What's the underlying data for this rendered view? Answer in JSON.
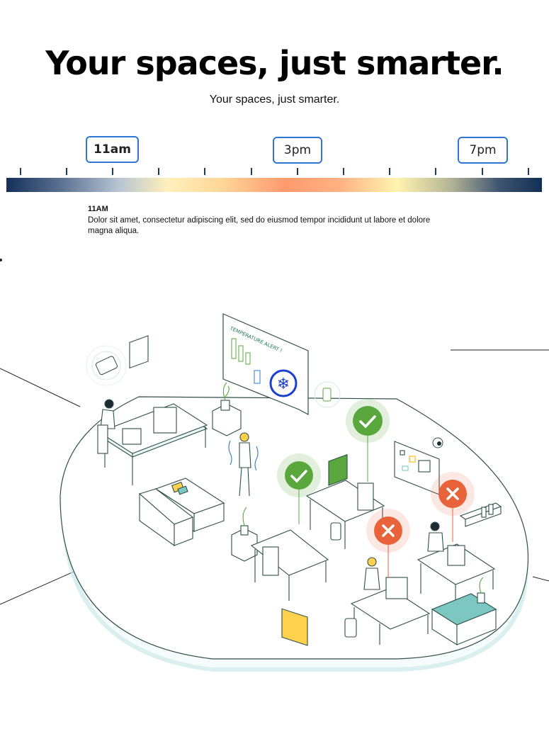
{
  "hero": {
    "headline": "Your spaces, just smarter.",
    "subheadline": "Your spaces, just smarter."
  },
  "timeline": {
    "buttons": [
      {
        "label": "11am",
        "selected": true
      },
      {
        "label": "3pm",
        "selected": false
      },
      {
        "label": "7pm",
        "selected": false
      }
    ],
    "gradient_colors": [
      "#14305a",
      "#b7c4d3",
      "#fff0bb",
      "#ff9a6e",
      "#fff3b0",
      "#112f55"
    ]
  },
  "info": {
    "time": "11AM",
    "description": "Dolor sit amet, consectetur adipiscing elit, sed do eiusmod tempor incididunt ut labore et dolore magna aliqua."
  },
  "illustration": {
    "alert_text": "TEMPERATURE ALERT !",
    "status_colors": {
      "available": "#5aa83d",
      "unavailable": "#e8633a",
      "accent": "#2f77d0"
    }
  }
}
